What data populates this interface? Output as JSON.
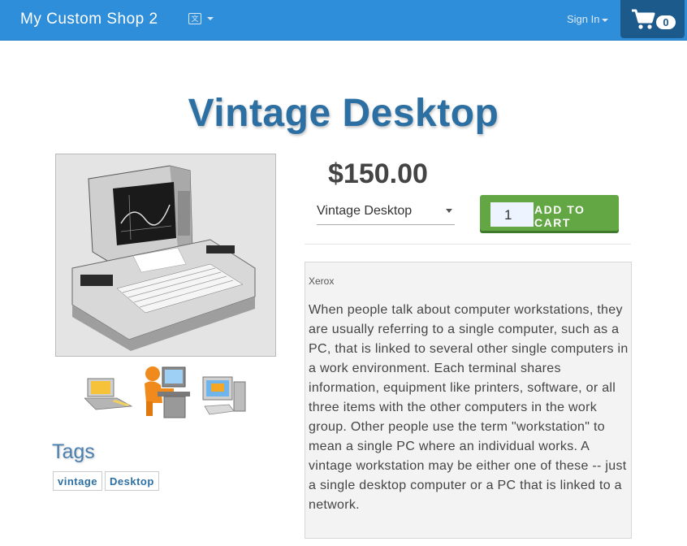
{
  "navbar": {
    "brand": "My Custom Shop 2",
    "language_icon": "language-flag-icon",
    "signin_label": "Sign In",
    "cart_icon": "shopping-cart-icon",
    "cart_count": "0",
    "color": "#2f8ed9"
  },
  "product": {
    "title": "Vintage Desktop",
    "price": "$150.00",
    "variant_selected": "Vintage Desktop",
    "quantity": "1",
    "add_to_cart_label": "ADD TO CART",
    "vendor": "Xerox",
    "description": "When people talk about computer workstations, they are usually referring to a single computer, such as a PC, that is linked to several other single computers in a work environment. Each terminal shares information, equipment like printers, software, or all three items with the other computers in the work group. Other people use the term \"workstation\" to mean a single PC where an individual works. A vintage workstation may be either one of these -- just a single desktop computer or a PC that is linked to a network.",
    "main_image": "vintage-computer-photo",
    "thumbnails": [
      "laptop-thumbnail",
      "person-at-computer-thumbnail",
      "desktop-pc-thumbnail"
    ]
  },
  "tags": {
    "heading": "Tags",
    "items": [
      "vintage",
      "Desktop"
    ]
  }
}
